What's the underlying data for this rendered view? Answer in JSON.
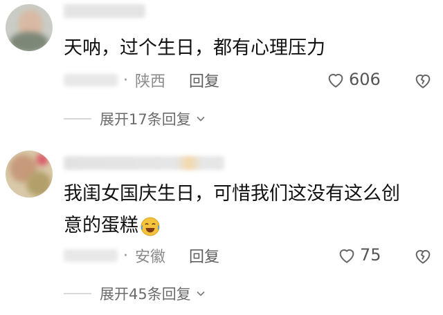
{
  "comments": [
    {
      "text": "天呐，过个生日，都有心理压力",
      "location": "陕西",
      "reply_label": "回复",
      "likes": "606",
      "expand_label": "展开17条回复"
    },
    {
      "text_line1": "我闺女国庆生日，可惜我们这没有这么创",
      "text_line2": "意的蛋糕",
      "emoji_name": "crying-laughing-emoji",
      "location": "安徽",
      "reply_label": "回复",
      "likes": "75",
      "expand_label": "展开45条回复"
    }
  ],
  "icons": {
    "like": "heart-outline-icon",
    "dislike": "broken-heart-icon",
    "expand": "chevron-down-icon"
  },
  "colors": {
    "text": "#111111",
    "meta": "#8a8a8a",
    "accent_emoji": "#f5c33b"
  }
}
